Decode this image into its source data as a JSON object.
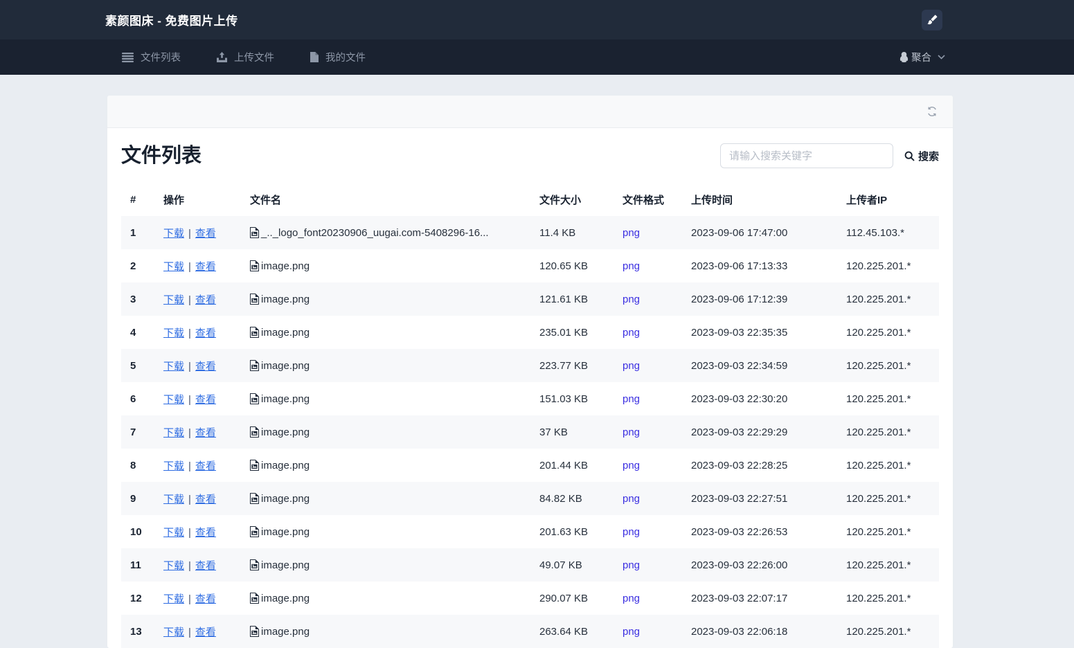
{
  "topbar": {
    "title": "素颜图床 - 免费图片上传"
  },
  "navbar": {
    "tabs": [
      {
        "label": "文件列表"
      },
      {
        "label": "上传文件"
      },
      {
        "label": "我的文件"
      }
    ],
    "user": {
      "label": "聚合"
    }
  },
  "panel": {
    "title": "文件列表",
    "search": {
      "placeholder": "请输入搜索关键字",
      "button_label": "搜索"
    }
  },
  "table": {
    "headers": [
      "#",
      "操作",
      "文件名",
      "文件大小",
      "文件格式",
      "上传时间",
      "上传者IP"
    ],
    "actions": {
      "download": "下载",
      "separator": "|",
      "view": "查看"
    },
    "rows": [
      {
        "index": "1",
        "name": "_.._logo_font20230906_uugai.com-5408296-16...",
        "size": "11.4 KB",
        "format": "png",
        "time": "2023-09-06 17:47:00",
        "ip": "112.45.103.*"
      },
      {
        "index": "2",
        "name": "image.png",
        "size": "120.65 KB",
        "format": "png",
        "time": "2023-09-06 17:13:33",
        "ip": "120.225.201.*"
      },
      {
        "index": "3",
        "name": "image.png",
        "size": "121.61 KB",
        "format": "png",
        "time": "2023-09-06 17:12:39",
        "ip": "120.225.201.*"
      },
      {
        "index": "4",
        "name": "image.png",
        "size": "235.01 KB",
        "format": "png",
        "time": "2023-09-03 22:35:35",
        "ip": "120.225.201.*"
      },
      {
        "index": "5",
        "name": "image.png",
        "size": "223.77 KB",
        "format": "png",
        "time": "2023-09-03 22:34:59",
        "ip": "120.225.201.*"
      },
      {
        "index": "6",
        "name": "image.png",
        "size": "151.03 KB",
        "format": "png",
        "time": "2023-09-03 22:30:20",
        "ip": "120.225.201.*"
      },
      {
        "index": "7",
        "name": "image.png",
        "size": "37 KB",
        "format": "png",
        "time": "2023-09-03 22:29:29",
        "ip": "120.225.201.*"
      },
      {
        "index": "8",
        "name": "image.png",
        "size": "201.44 KB",
        "format": "png",
        "time": "2023-09-03 22:28:25",
        "ip": "120.225.201.*"
      },
      {
        "index": "9",
        "name": "image.png",
        "size": "84.82 KB",
        "format": "png",
        "time": "2023-09-03 22:27:51",
        "ip": "120.225.201.*"
      },
      {
        "index": "10",
        "name": "image.png",
        "size": "201.63 KB",
        "format": "png",
        "time": "2023-09-03 22:26:53",
        "ip": "120.225.201.*"
      },
      {
        "index": "11",
        "name": "image.png",
        "size": "49.07 KB",
        "format": "png",
        "time": "2023-09-03 22:26:00",
        "ip": "120.225.201.*"
      },
      {
        "index": "12",
        "name": "image.png",
        "size": "290.07 KB",
        "format": "png",
        "time": "2023-09-03 22:07:17",
        "ip": "120.225.201.*"
      },
      {
        "index": "13",
        "name": "image.png",
        "size": "263.64 KB",
        "format": "png",
        "time": "2023-09-03 22:06:18",
        "ip": "120.225.201.*"
      }
    ]
  },
  "colors": {
    "topbar_bg": "#212b3a",
    "navbar_bg": "#1a2230",
    "page_bg": "#e9edf2",
    "action_link": "#2e6ce2",
    "format_link": "#3b2fe1"
  }
}
